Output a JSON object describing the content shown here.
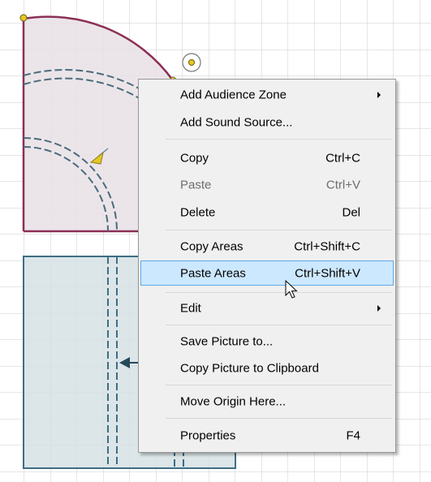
{
  "context_menu": {
    "items": [
      {
        "label": "Add Audience Zone",
        "shortcut": "",
        "submenu": true
      },
      {
        "label": "Add Sound Source...",
        "shortcut": ""
      },
      {
        "label": "Copy",
        "shortcut": "Ctrl+C"
      },
      {
        "label": "Paste",
        "shortcut": "Ctrl+V",
        "disabled": true
      },
      {
        "label": "Delete",
        "shortcut": "Del"
      },
      {
        "label": "Copy Areas",
        "shortcut": "Ctrl+Shift+C"
      },
      {
        "label": "Paste Areas",
        "shortcut": "Ctrl+Shift+V",
        "highlighted": true
      },
      {
        "label": "Edit",
        "shortcut": "",
        "submenu": true
      },
      {
        "label": "Save Picture to...",
        "shortcut": ""
      },
      {
        "label": "Copy Picture to Clipboard",
        "shortcut": ""
      },
      {
        "label": "Move Origin Here...",
        "shortcut": ""
      },
      {
        "label": "Properties",
        "shortcut": "F4"
      }
    ]
  },
  "colors": {
    "grid_line": "#c8c8c8",
    "upper_zone_fill": "#e7e0e5",
    "upper_zone_border": "#8b2f55",
    "lower_zone_fill": "#d6e0e4",
    "lower_zone_border": "#3e6e84",
    "vertex_handle": "#e6c822",
    "menu_highlight": "#cce8ff",
    "menu_highlight_border": "#5fa8e6"
  }
}
